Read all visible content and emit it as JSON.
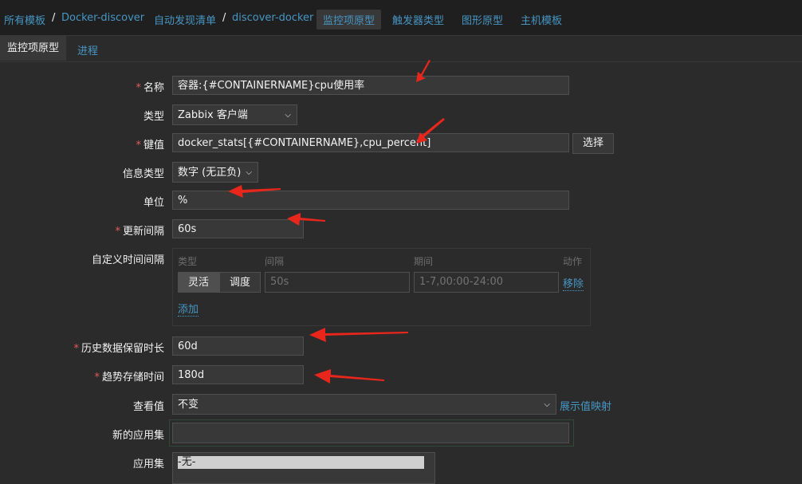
{
  "breadcrumbs": {
    "all_templates": "所有模板",
    "sep": "/",
    "template": "Docker-discover",
    "discovery_list": "自动发现清单",
    "discovery_rule": "discover-docker",
    "item_prototypes": "监控项原型",
    "trigger_prototypes": "触发器类型",
    "graph_prototypes": "图形原型",
    "host_prototypes": "主机模板"
  },
  "tabs": {
    "item_prototype": "监控项原型",
    "process": "进程"
  },
  "form": {
    "required_mark": "*",
    "name": {
      "label": "名称",
      "value": "容器:{#CONTAINERNAME}cpu使用率"
    },
    "type": {
      "label": "类型",
      "value": "Zabbix 客户端"
    },
    "key": {
      "label": "键值",
      "value": "docker_stats[{#CONTAINERNAME},cpu_percent]",
      "select_button": "选择"
    },
    "info_type": {
      "label": "信息类型",
      "value": "数字 (无正负)"
    },
    "units": {
      "label": "单位",
      "value": "%"
    },
    "update_interval": {
      "label": "更新间隔",
      "value": "60s"
    },
    "custom_intervals": {
      "label": "自定义时间间隔",
      "col_type": "类型",
      "col_interval": "间隔",
      "col_period": "期间",
      "col_action": "动作",
      "flexible": "灵活",
      "scheduling": "调度",
      "interval_placeholder": "50s",
      "period_placeholder": "1-7,00:00-24:00",
      "remove": "移除",
      "add": "添加"
    },
    "history": {
      "label": "历史数据保留时长",
      "value": "60d"
    },
    "trends": {
      "label": "趋势存储时间",
      "value": "180d"
    },
    "show_value": {
      "label": "查看值",
      "value": "不变",
      "mapping_link": "展示值映射"
    },
    "new_application": {
      "label": "新的应用集",
      "value": ""
    },
    "applications": {
      "label": "应用集",
      "options": [
        "-无-"
      ]
    }
  },
  "colors": {
    "background": "#2b2b2b",
    "link": "#4796c4",
    "required": "#e45959",
    "annotation_arrow": "#e8261c"
  },
  "icons": {
    "select_caret": "chevron-down-icon",
    "annotation": "red-arrow-icon"
  }
}
